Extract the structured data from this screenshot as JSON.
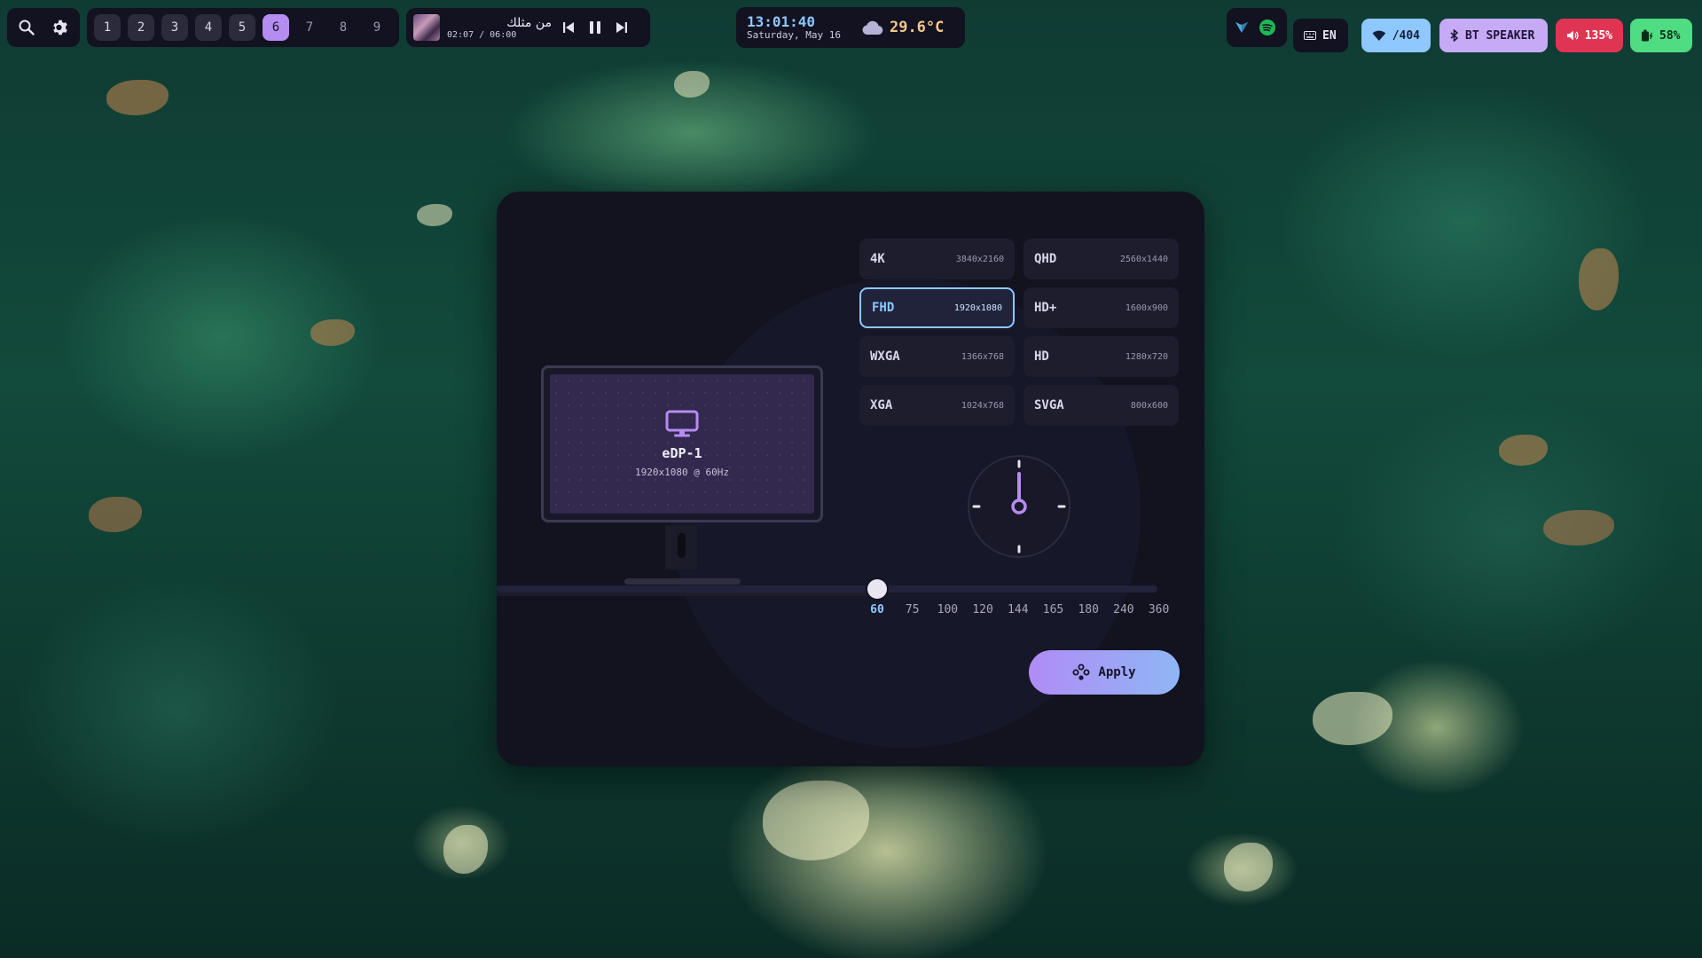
{
  "workspaces": [
    {
      "label": "1",
      "state": "occ"
    },
    {
      "label": "2",
      "state": "occ"
    },
    {
      "label": "3",
      "state": "occ"
    },
    {
      "label": "4",
      "state": "occ"
    },
    {
      "label": "5",
      "state": "occ"
    },
    {
      "label": "6",
      "state": "active"
    },
    {
      "label": "7",
      "state": "empty"
    },
    {
      "label": "8",
      "state": "empty"
    },
    {
      "label": "9",
      "state": "empty"
    }
  ],
  "media": {
    "title": "من مثلك",
    "time": "02:07 / 06:00"
  },
  "clock": {
    "time": "13:01:40",
    "date": "Saturday, May 16"
  },
  "weather": {
    "temp": "29.6°C"
  },
  "status": {
    "language": "EN",
    "wifi": "/404",
    "bluetooth": "BT SPEAKER",
    "volume": "135%",
    "battery": "58%"
  },
  "colors": {
    "accent": "#b58cf0",
    "selected": "#8ec8ff",
    "wifi": "#8ec8ff",
    "bluetooth": "#c7aaf5",
    "volume": "#e03552",
    "battery": "#4fdc82",
    "spotify": "#1db954"
  },
  "display": {
    "name": "eDP-1",
    "mode": "1920x1080 @ 60Hz"
  },
  "resolutions": [
    {
      "name": "4K",
      "dim": "3840x2160"
    },
    {
      "name": "QHD",
      "dim": "2560x1440"
    },
    {
      "name": "FHD",
      "dim": "1920x1080",
      "selected": true
    },
    {
      "name": "HD+",
      "dim": "1600x900"
    },
    {
      "name": "WXGA",
      "dim": "1366x768"
    },
    {
      "name": "HD",
      "dim": "1280x720"
    },
    {
      "name": "XGA",
      "dim": "1024x768"
    },
    {
      "name": "SVGA",
      "dim": "800x600"
    }
  ],
  "refresh_rates": [
    "60",
    "75",
    "100",
    "120",
    "144",
    "165",
    "180",
    "240",
    "360"
  ],
  "refresh_selected": "60",
  "apply_label": "Apply"
}
